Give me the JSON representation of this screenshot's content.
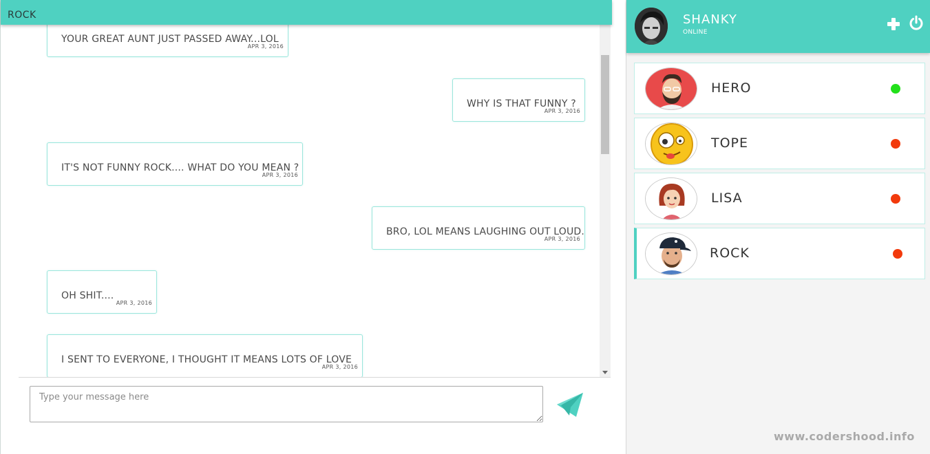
{
  "chat": {
    "title": "ROCK",
    "messages": [
      {
        "text": "YOUR GREAT AUNT JUST PASSED AWAY...LOL",
        "time": "APR 3, 2016",
        "side": "left"
      },
      {
        "text": "WHY IS THAT FUNNY ?",
        "time": "APR 3, 2016",
        "side": "right"
      },
      {
        "text": "IT'S NOT FUNNY ROCK.... WHAT DO YOU MEAN ?",
        "time": "APR 3, 2016",
        "side": "left"
      },
      {
        "text": "BRO, LOL MEANS LAUGHING OUT LOUD.",
        "time": "APR 3, 2016",
        "side": "right"
      },
      {
        "text": "OH SHIT....",
        "time": "APR 3, 2016",
        "side": "left"
      },
      {
        "text": "I SENT TO EVERYONE, I THOUGHT IT MEANS LOTS OF LOVE",
        "time": "APR 3, 2016",
        "side": "left"
      }
    ],
    "input": {
      "placeholder": "Type your message here",
      "value": ""
    },
    "send_icon": "paper-plane-icon"
  },
  "profile": {
    "name": "SHANKY",
    "status": "ONLINE",
    "add_icon": "plus-icon",
    "power_icon": "power-icon"
  },
  "contacts": [
    {
      "name": "HERO",
      "status": "online",
      "status_color": "#22e01a",
      "avatar": "bearded-man-avatar"
    },
    {
      "name": "TOPE",
      "status": "offline",
      "status_color": "#f23a0c",
      "avatar": "crazy-emoji-avatar"
    },
    {
      "name": "LISA",
      "status": "offline",
      "status_color": "#f23a0c",
      "avatar": "woman-avatar"
    },
    {
      "name": "ROCK",
      "status": "offline",
      "status_color": "#f23a0c",
      "avatar": "cap-man-avatar",
      "active": true
    }
  ],
  "colors": {
    "accent": "#4fd1c1",
    "online": "#22e01a",
    "offline": "#f23a0c"
  },
  "watermark": "www.codershood.info"
}
